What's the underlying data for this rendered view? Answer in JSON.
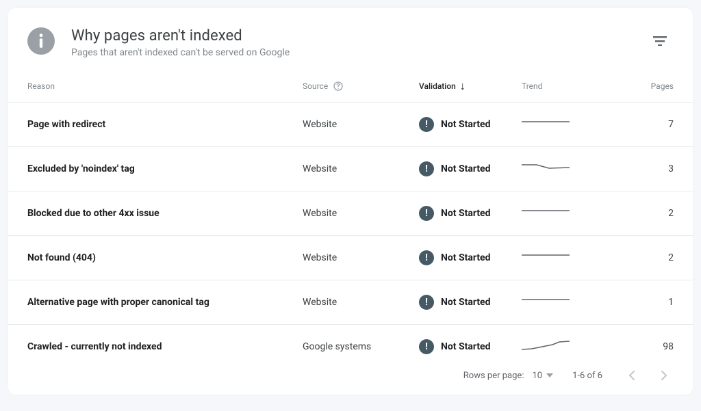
{
  "header": {
    "title": "Why pages aren't indexed",
    "subtitle": "Pages that aren't indexed can't be served on Google"
  },
  "columns": {
    "reason": "Reason",
    "source": "Source",
    "validation": "Validation",
    "trend": "Trend",
    "pages": "Pages",
    "sort_by": "validation",
    "sort_dir": "desc"
  },
  "rows": [
    {
      "reason": "Page with redirect",
      "source": "Website",
      "validation": "Not Started",
      "pages": 7,
      "trend": "flat"
    },
    {
      "reason": "Excluded by 'noindex' tag",
      "source": "Website",
      "validation": "Not Started",
      "pages": 3,
      "trend": "dip"
    },
    {
      "reason": "Blocked due to other 4xx issue",
      "source": "Website",
      "validation": "Not Started",
      "pages": 2,
      "trend": "flat"
    },
    {
      "reason": "Not found (404)",
      "source": "Website",
      "validation": "Not Started",
      "pages": 2,
      "trend": "flat"
    },
    {
      "reason": "Alternative page with proper canonical tag",
      "source": "Website",
      "validation": "Not Started",
      "pages": 1,
      "trend": "flat"
    },
    {
      "reason": "Crawled - currently not indexed",
      "source": "Google systems",
      "validation": "Not Started",
      "pages": 98,
      "trend": "rise"
    }
  ],
  "pagination": {
    "rows_per_page_label": "Rows per page:",
    "rows_per_page_value": "10",
    "range_label": "1-6 of 6",
    "prev_disabled": true,
    "next_disabled": true
  }
}
